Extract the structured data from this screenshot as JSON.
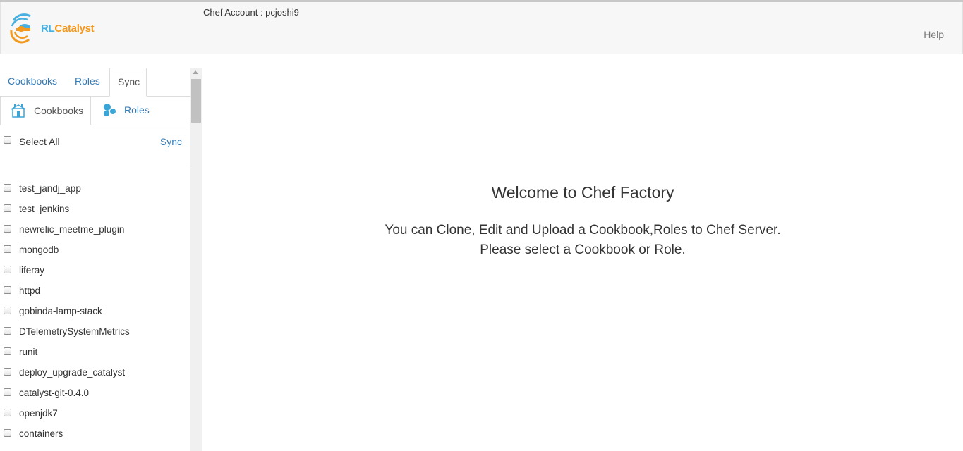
{
  "header": {
    "logo": {
      "rl": "RL",
      "catalyst": "Catalyst"
    },
    "chef_account": "Chef Account : pcjoshi9",
    "help": "Help"
  },
  "sidebar": {
    "main_tabs": [
      {
        "label": "Cookbooks",
        "active": false
      },
      {
        "label": "Roles",
        "active": false
      },
      {
        "label": "Sync",
        "active": true
      }
    ],
    "sync_tabs": [
      {
        "label": "Cookbooks",
        "icon": "cookbook-icon",
        "active": true
      },
      {
        "label": "Roles",
        "icon": "roles-icon",
        "active": false
      }
    ],
    "select_all": "Select All",
    "sync_label": "Sync",
    "items": [
      "test_jandj_app",
      "test_jenkins",
      "newrelic_meetme_plugin",
      "mongodb",
      "liferay",
      "httpd",
      "gobinda-lamp-stack",
      "DTelemetrySystemMetrics",
      "runit",
      "deploy_upgrade_catalyst",
      "catalyst-git-0.4.0",
      "openjdk7",
      "containers"
    ]
  },
  "main": {
    "title": "Welcome to Chef Factory",
    "line1": "You can Clone, Edit and Upload a Cookbook,Roles to Chef Server.",
    "line2": "Please select a Cookbook or Role."
  },
  "colors": {
    "link": "#337ab7",
    "brand_blue": "#48b0e0",
    "brand_orange": "#f29a1f"
  }
}
